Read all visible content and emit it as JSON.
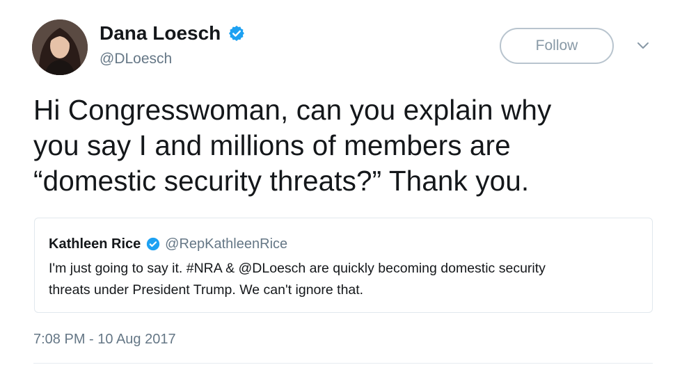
{
  "author": {
    "display_name": "Dana Loesch",
    "handle": "@DLoesch",
    "verified": true
  },
  "follow_button": {
    "label": "Follow"
  },
  "tweet": {
    "text_lines": [
      "Hi Congresswoman, can you explain why",
      "you say I and millions of members are",
      "“domestic security threats?” Thank you."
    ],
    "timestamp": "7:08 PM - 10 Aug 2017"
  },
  "quoted_tweet": {
    "display_name": "Kathleen Rice",
    "handle": "@RepKathleenRice",
    "verified": true,
    "text_lines": [
      "I'm just going to say it. #NRA & @DLoesch are quickly becoming domestic security",
      "threats under President Trump. We can't ignore that."
    ]
  },
  "icons": {
    "verified": "verified-badge-icon",
    "more": "chevron-down-icon"
  },
  "colors": {
    "verified_blue": "#1da1f2",
    "secondary_text": "#657786",
    "border": "#e1e8ed"
  }
}
